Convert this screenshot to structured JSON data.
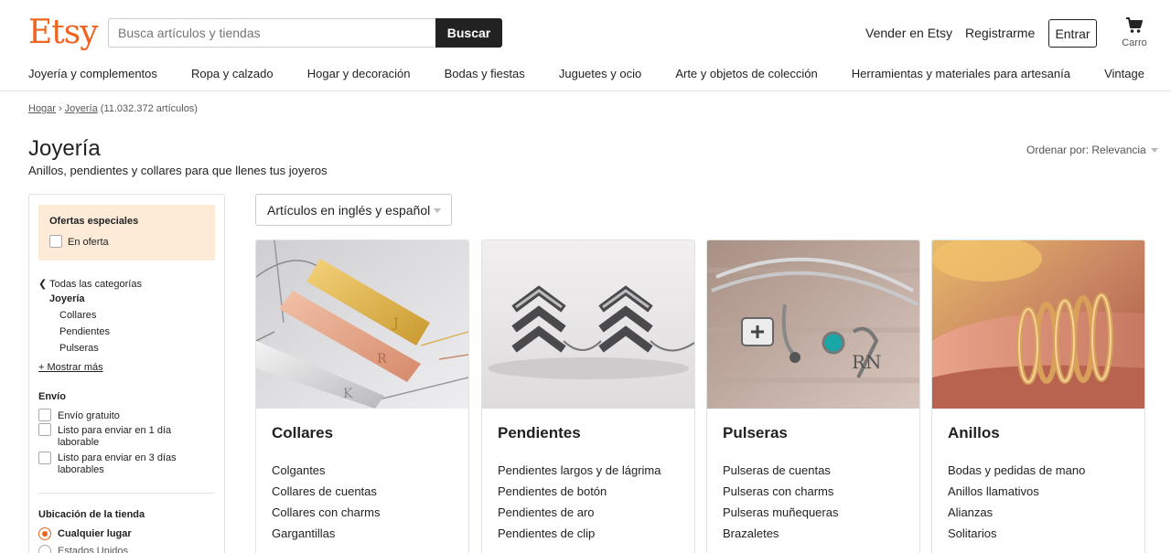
{
  "header": {
    "logo": "Etsy",
    "search_placeholder": "Busca artículos y tiendas",
    "search_button": "Buscar",
    "sell_link": "Vender en Etsy",
    "register_link": "Registrarme",
    "signin_button": "Entrar",
    "cart_label": "Carro",
    "brand_color": "#f1641e"
  },
  "nav": [
    "Joyería y complementos",
    "Ropa y calzado",
    "Hogar y decoración",
    "Bodas y fiestas",
    "Juguetes y ocio",
    "Arte y objetos de colección",
    "Herramientas y materiales para artesanía",
    "Vintage"
  ],
  "breadcrumb": {
    "home": "Hogar",
    "current": "Joyería",
    "count": "(11.032.372 artículos)"
  },
  "page": {
    "title": "Joyería",
    "subtitle": "Anillos, pendientes y collares para que llenes tus joyeros",
    "sort_label": "Ordenar por: Relevancia",
    "language_filter": "Artículos en inglés y español"
  },
  "sidebar": {
    "offers_title": "Ofertas especiales",
    "on_sale": "En oferta",
    "all_categories": "Todas las categorías",
    "current_category": "Joyería",
    "subcategories": [
      "Collares",
      "Pendientes",
      "Pulseras"
    ],
    "show_more": "+ Mostrar más",
    "shipping_title": "Envío",
    "shipping_free": "Envío gratuito",
    "shipping_1day_a": "Listo para enviar en 1 día",
    "shipping_1day_b": "laborable",
    "shipping_3day_a": "Listo para enviar en 3 días",
    "shipping_3day_b": "laborables",
    "location_title": "Ubicación de la tienda",
    "location_any": "Cualquier lugar",
    "location_us": "Estados Unidos"
  },
  "cards": [
    {
      "title": "Collares",
      "links": [
        "Colgantes",
        "Collares de cuentas",
        "Collares con charms",
        "Gargantillas"
      ]
    },
    {
      "title": "Pendientes",
      "links": [
        "Pendientes largos y de lágrima",
        "Pendientes de botón",
        "Pendientes de aro",
        "Pendientes de clip"
      ]
    },
    {
      "title": "Pulseras",
      "links": [
        "Pulseras de cuentas",
        "Pulseras con charms",
        "Pulseras muñequeras",
        "Brazaletes"
      ]
    },
    {
      "title": "Anillos",
      "links": [
        "Bodas y pedidas de mano",
        "Anillos llamativos",
        "Alianzas",
        "Solitarios"
      ]
    }
  ]
}
